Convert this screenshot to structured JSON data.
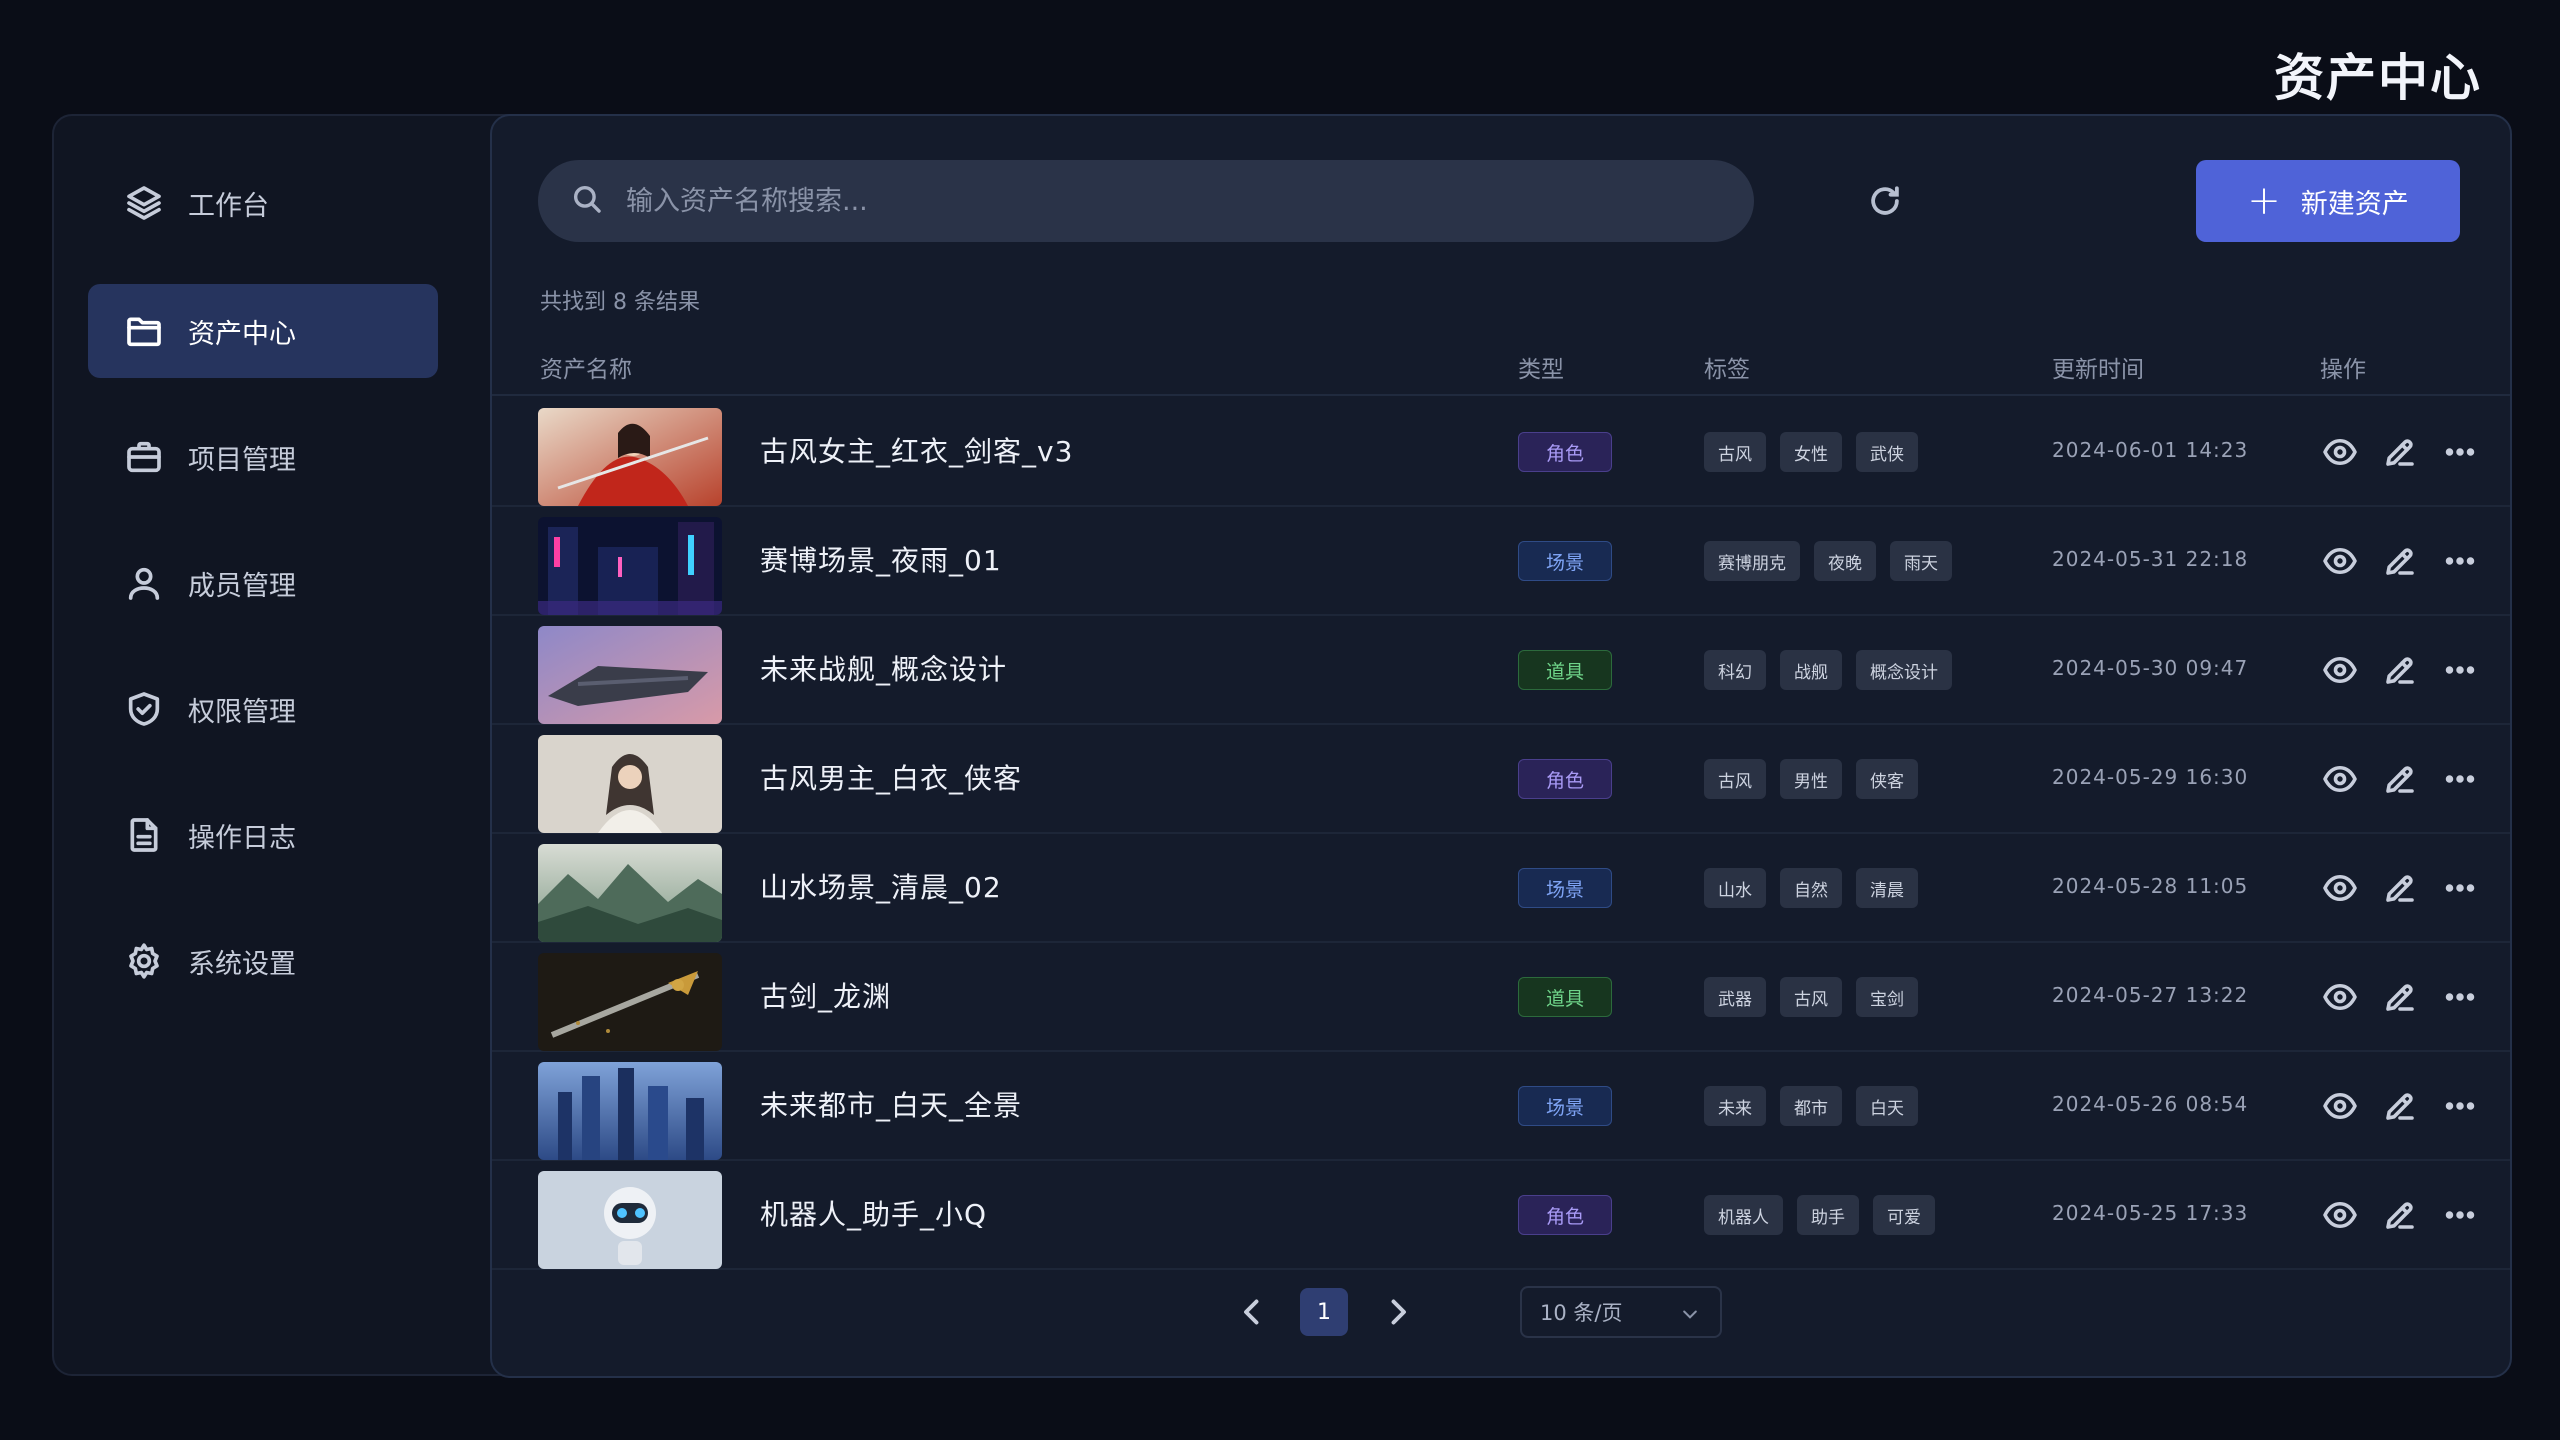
{
  "page_title": "资产中心",
  "sidebar": {
    "items": [
      {
        "label": "工作台",
        "icon": "layers-icon",
        "active": false
      },
      {
        "label": "资产中心",
        "icon": "folder-icon",
        "active": true
      },
      {
        "label": "项目管理",
        "icon": "briefcase-icon",
        "active": false
      },
      {
        "label": "成员管理",
        "icon": "user-icon",
        "active": false
      },
      {
        "label": "权限管理",
        "icon": "shield-check-icon",
        "active": false
      },
      {
        "label": "操作日志",
        "icon": "document-icon",
        "active": false
      },
      {
        "label": "系统设置",
        "icon": "gear-icon",
        "active": false
      }
    ]
  },
  "search": {
    "placeholder": "输入资产名称搜索...",
    "value": ""
  },
  "toolbar": {
    "new_label": "新建资产",
    "refresh_icon": "refresh-icon",
    "new_icon": "plus-icon"
  },
  "result_count": "共找到 8 条结果",
  "table": {
    "headers": {
      "name": "资产名称",
      "type": "类型",
      "tags": "标签",
      "updated": "更新时间",
      "actions": "操作"
    },
    "rows": [
      {
        "name": "古风女主_红衣_剑客_v3",
        "type": "角色",
        "type_kind": "role",
        "tags": [
          "古风",
          "女性",
          "武侠"
        ],
        "updated": "2024-06-01 14:23"
      },
      {
        "name": "赛博场景_夜雨_01",
        "type": "场景",
        "type_kind": "scene",
        "tags": [
          "赛博朋克",
          "夜晚",
          "雨天"
        ],
        "updated": "2024-05-31 22:18"
      },
      {
        "name": "未来战舰_概念设计",
        "type": "道具",
        "type_kind": "prop",
        "tags": [
          "科幻",
          "战舰",
          "概念设计"
        ],
        "updated": "2024-05-30 09:47"
      },
      {
        "name": "古风男主_白衣_侠客",
        "type": "角色",
        "type_kind": "role",
        "tags": [
          "古风",
          "男性",
          "侠客"
        ],
        "updated": "2024-05-29 16:30"
      },
      {
        "name": "山水场景_清晨_02",
        "type": "场景",
        "type_kind": "scene",
        "tags": [
          "山水",
          "自然",
          "清晨"
        ],
        "updated": "2024-05-28 11:05"
      },
      {
        "name": "古剑_龙渊",
        "type": "道具",
        "type_kind": "prop",
        "tags": [
          "武器",
          "古风",
          "宝剑"
        ],
        "updated": "2024-05-27 13:22"
      },
      {
        "name": "未来都市_白天_全景",
        "type": "场景",
        "type_kind": "scene",
        "tags": [
          "未来",
          "都市",
          "白天"
        ],
        "updated": "2024-05-26 08:54"
      },
      {
        "name": "机器人_助手_小Q",
        "type": "角色",
        "type_kind": "role",
        "tags": [
          "机器人",
          "助手",
          "可爱"
        ],
        "updated": "2024-05-25 17:33"
      }
    ]
  },
  "pagination": {
    "current": "1",
    "page_size": "10 条/页"
  },
  "colors": {
    "accent": "#4f63d8",
    "active_nav": "#26345e",
    "background": "#0a0d17"
  }
}
